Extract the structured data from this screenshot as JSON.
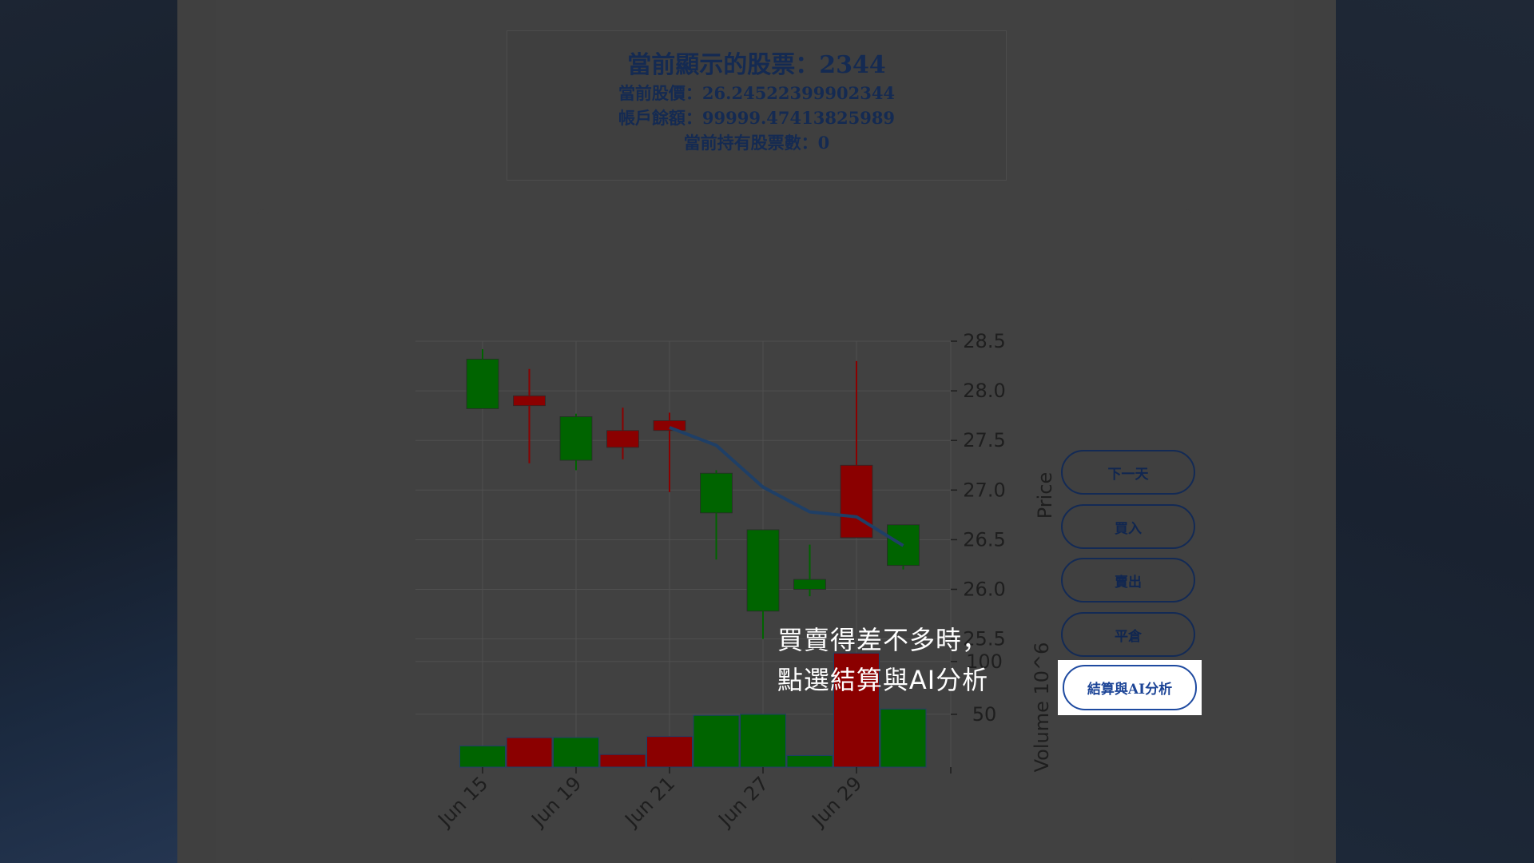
{
  "info": {
    "title": "當前顯示的股票：2344",
    "price": "當前股價：26.24522399902344",
    "balance": "帳戶餘額：99999.47413825989",
    "holdings": "當前持有股票數：0"
  },
  "buttons": {
    "next_day": "下一天",
    "buy": "買入",
    "sell": "賣出",
    "close_position": "平倉",
    "settle_ai": "結算與AI分析"
  },
  "caption": {
    "line1": "買賣得差不多時，",
    "line2": "點選結算與AI分析"
  },
  "colors": {
    "up": "#006400",
    "down": "#8b0000",
    "ma_line": "#1f3f66",
    "grid": "#505050",
    "axis_text": "#1e1e1e"
  },
  "chart_data": {
    "type": "candlestick",
    "price_ylabel": "Price",
    "volume_ylabel": "Volume  10^6",
    "price_ticks": [
      "28.5",
      "28.0",
      "27.5",
      "27.0",
      "26.5",
      "26.0",
      "25.5"
    ],
    "volume_ticks": [
      "100",
      "50"
    ],
    "x_tick_labels": [
      "Jun 15",
      "Jun 19",
      "Jun 21",
      "Jun 27",
      "Jun 29"
    ],
    "x_tick_indices": [
      0,
      2,
      4,
      6,
      8
    ],
    "price_ylim": [
      25.4,
      28.5
    ],
    "volume_ylim": [
      0,
      112
    ],
    "candles": [
      {
        "open": 27.82,
        "high": 28.42,
        "low": 27.82,
        "close": 28.32,
        "volume": 20
      },
      {
        "open": 27.95,
        "high": 28.22,
        "low": 27.27,
        "close": 27.85,
        "volume": 28
      },
      {
        "open": 27.3,
        "high": 27.77,
        "low": 27.2,
        "close": 27.74,
        "volume": 28
      },
      {
        "open": 27.6,
        "high": 27.83,
        "low": 27.31,
        "close": 27.43,
        "volume": 12
      },
      {
        "open": 27.7,
        "high": 27.78,
        "low": 26.98,
        "close": 27.6,
        "volume": 29
      },
      {
        "open": 26.77,
        "high": 27.2,
        "low": 26.3,
        "close": 27.17,
        "volume": 49
      },
      {
        "open": 25.78,
        "high": 26.6,
        "low": 25.5,
        "close": 26.6,
        "volume": 50
      },
      {
        "open": 26.0,
        "high": 26.45,
        "low": 25.93,
        "close": 26.1,
        "volume": 11
      },
      {
        "open": 27.25,
        "high": 28.3,
        "low": 26.52,
        "close": 26.52,
        "volume": 108
      },
      {
        "open": 26.24,
        "high": 26.65,
        "low": 26.2,
        "close": 26.65,
        "volume": 55
      }
    ],
    "moving_average": [
      null,
      null,
      null,
      null,
      27.63,
      27.45,
      27.03,
      26.78,
      26.73,
      26.44
    ]
  }
}
